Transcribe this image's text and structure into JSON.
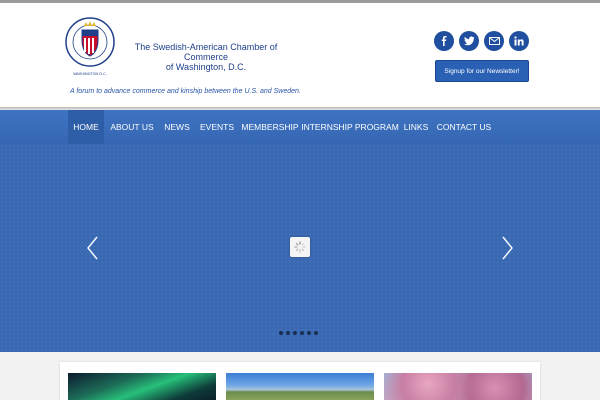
{
  "header": {
    "org_title_line1": "The Swedish-American Chamber of Commerce",
    "org_title_line2": "of Washington, D.C.",
    "tagline": "A forum to advance commerce and kinship between the U.S. and Sweden.",
    "newsletter_label": "Signup for our Newsletter!",
    "social": [
      {
        "name": "facebook",
        "glyph": "f"
      },
      {
        "name": "twitter",
        "glyph": "t"
      },
      {
        "name": "email",
        "glyph": "@"
      },
      {
        "name": "linkedin",
        "glyph": "in"
      }
    ]
  },
  "nav": {
    "items": [
      {
        "label": "HOME",
        "active": true
      },
      {
        "label": "ABOUT US"
      },
      {
        "label": "NEWS"
      },
      {
        "label": "EVENTS"
      },
      {
        "label": "MEMBERSHIP"
      },
      {
        "label": "INTERNSHIP PROGRAM"
      },
      {
        "label": "LINKS"
      },
      {
        "label": "CONTACT US"
      }
    ]
  },
  "slider": {
    "slide_count": 6,
    "colors": {
      "background": "#3a69b4",
      "dot": "#1a2f55"
    }
  },
  "colors": {
    "brand_blue": "#1f4f9e",
    "nav_blue": "#3f74c2",
    "text_blue": "#1f3f8a"
  }
}
